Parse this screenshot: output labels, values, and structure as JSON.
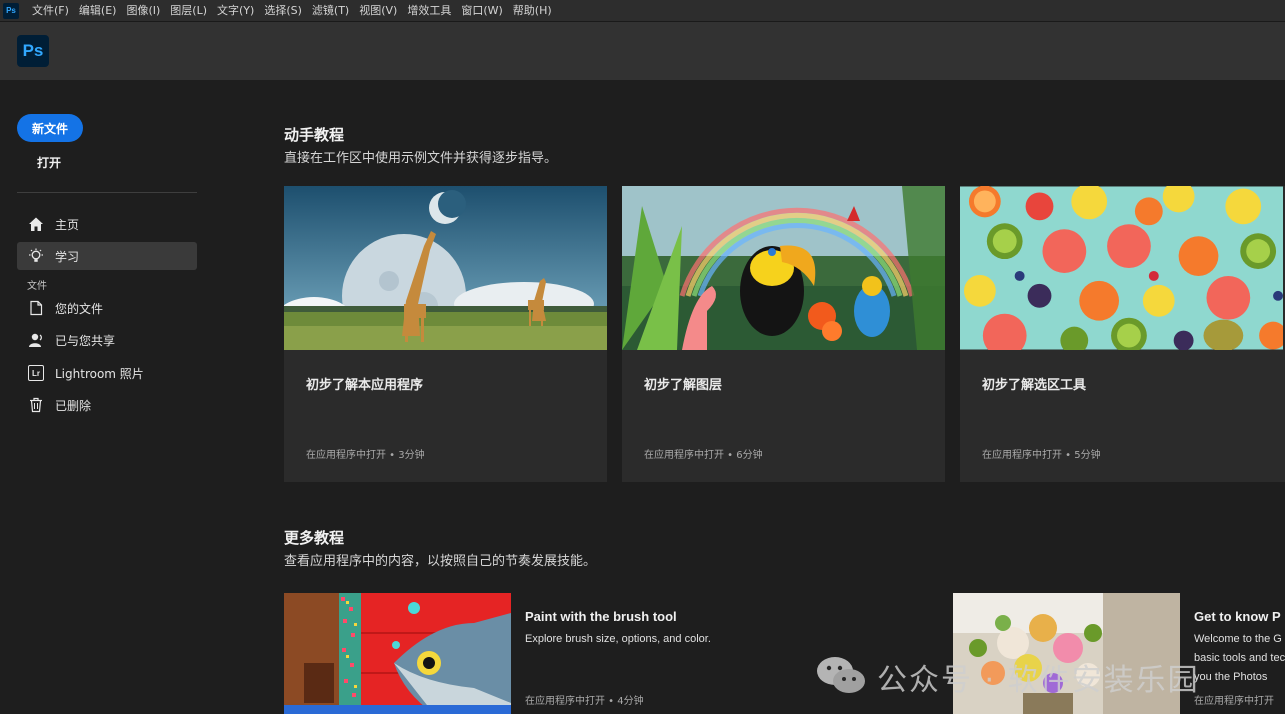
{
  "app": {
    "mini_logo": "Ps",
    "logo": "Ps"
  },
  "menubar": {
    "items": [
      "文件(F)",
      "编辑(E)",
      "图像(I)",
      "图层(L)",
      "文字(Y)",
      "选择(S)",
      "滤镜(T)",
      "视图(V)",
      "增效工具",
      "窗口(W)",
      "帮助(H)"
    ]
  },
  "sidebar": {
    "new_file": "新文件",
    "open": "打开",
    "files_section": "文件",
    "nav": [
      {
        "label": "主页",
        "icon": "home-icon"
      },
      {
        "label": "学习",
        "icon": "lightbulb-icon",
        "active": true
      },
      {
        "label": "您的文件",
        "icon": "file-icon"
      },
      {
        "label": "已与您共享",
        "icon": "shared-user-icon"
      },
      {
        "label": "Lightroom 照片",
        "icon": "lightroom-icon",
        "icon_text": "Lr"
      },
      {
        "label": "已删除",
        "icon": "trash-icon"
      }
    ]
  },
  "hands_on": {
    "title": "动手教程",
    "subtitle": "直接在工作区中使用示例文件并获得逐步指导。",
    "cards": [
      {
        "title": "初步了解本应用程序",
        "meta": "在应用程序中打开 • 3分钟"
      },
      {
        "title": "初步了解图层",
        "meta": "在应用程序中打开 • 6分钟"
      },
      {
        "title": "初步了解选区工具",
        "meta": "在应用程序中打开 • 5分钟"
      }
    ]
  },
  "more": {
    "title": "更多教程",
    "subtitle": "查看应用程序中的内容，以按照自己的节奏发展技能。",
    "items": [
      {
        "title": "Paint with the brush tool",
        "desc": "Explore brush size, options, and color.",
        "meta": "在应用程序中打开 • 4分钟"
      },
      {
        "title": "Get to know P",
        "desc_lines": [
          "Welcome to the G",
          "basic tools and tec",
          "you the Photos"
        ],
        "meta": "在应用程序中打开"
      }
    ]
  },
  "watermark": {
    "text": "公众号 · 软件安装乐园"
  },
  "colors": {
    "accent": "#1473e6",
    "ps_blue": "#31a8ff",
    "ps_dark": "#001e36"
  }
}
